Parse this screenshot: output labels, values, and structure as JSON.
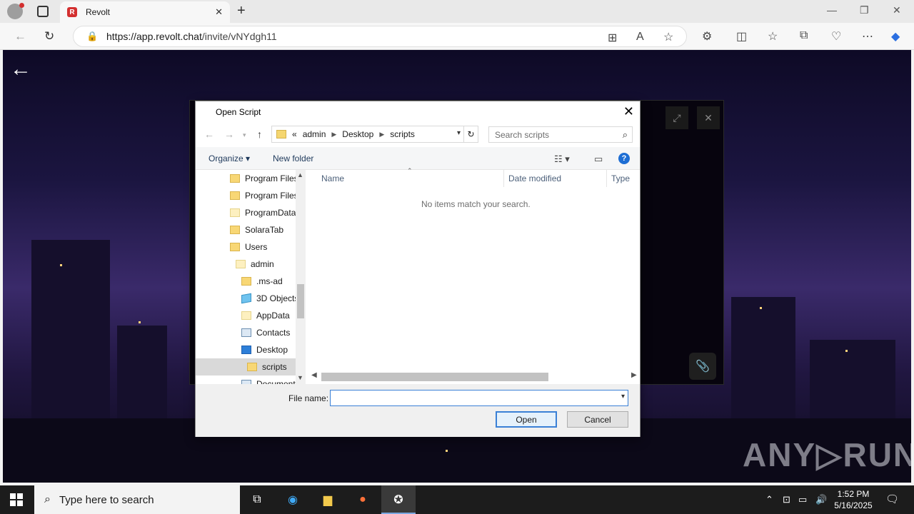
{
  "browser": {
    "tab_title": "Revolt",
    "tab_icon_letter": "R",
    "url_host": "https://app.revolt.chat",
    "url_path": "/invite/vNYdgh11"
  },
  "page": {
    "watermark": "ANY▷RUN"
  },
  "dialog": {
    "title": "Open Script",
    "path": [
      "admin",
      "Desktop",
      "scripts"
    ],
    "path_prefix": "«",
    "search_placeholder": "Search scripts",
    "organize_label": "Organize ▾",
    "new_folder_label": "New folder",
    "help_label": "?",
    "nav_items": [
      {
        "label": "Program Files",
        "indent": 0,
        "icon": "folder"
      },
      {
        "label": "Program Files",
        "indent": 0,
        "icon": "folder"
      },
      {
        "label": "ProgramData",
        "indent": 0,
        "icon": "folder-light"
      },
      {
        "label": "SolaraTab",
        "indent": 0,
        "icon": "folder"
      },
      {
        "label": "Users",
        "indent": 0,
        "icon": "folder"
      },
      {
        "label": "admin",
        "indent": 1,
        "icon": "folder-light"
      },
      {
        "label": ".ms-ad",
        "indent": 2,
        "icon": "folder"
      },
      {
        "label": "3D Objects",
        "indent": 2,
        "icon": "cube"
      },
      {
        "label": "AppData",
        "indent": 2,
        "icon": "folder-light"
      },
      {
        "label": "Contacts",
        "indent": 2,
        "icon": "card"
      },
      {
        "label": "Desktop",
        "indent": 2,
        "icon": "desktop"
      },
      {
        "label": "scripts",
        "indent": 3,
        "icon": "folder",
        "selected": true
      },
      {
        "label": "Documents",
        "indent": 2,
        "icon": "card"
      }
    ],
    "columns": {
      "name": "Name",
      "date": "Date modified",
      "type": "Type"
    },
    "empty_message": "No items match your search.",
    "file_name_label": "File name:",
    "file_name_value": "",
    "open_label": "Open",
    "cancel_label": "Cancel"
  },
  "taskbar": {
    "search_placeholder": "Type here to search",
    "time": "1:52 PM",
    "date": "5/16/2025"
  },
  "colors": {
    "accent": "#3a80d6",
    "revolt_red": "#d32f2f"
  }
}
